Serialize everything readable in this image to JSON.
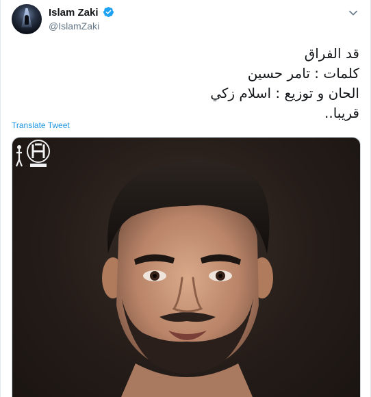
{
  "tweet": {
    "author": {
      "display_name": "Islam Zaki",
      "handle": "@IslamZaki",
      "verified": true,
      "avatar_icon": "profile-avatar"
    },
    "menu_icon": "chevron-down-icon",
    "text_lines": [
      "قد الفراق",
      "كلمات : تامر حسين",
      "الحان و توزيع : اسلام زكي",
      "قريبا.."
    ],
    "translate_label": "Translate Tweet",
    "media": {
      "kind": "photo",
      "description_icon": "portrait-photo"
    }
  },
  "colors": {
    "link": "#1b95e0",
    "verified": "#1da1f2",
    "secondary_text": "#657786",
    "border": "#e1e8ed"
  }
}
